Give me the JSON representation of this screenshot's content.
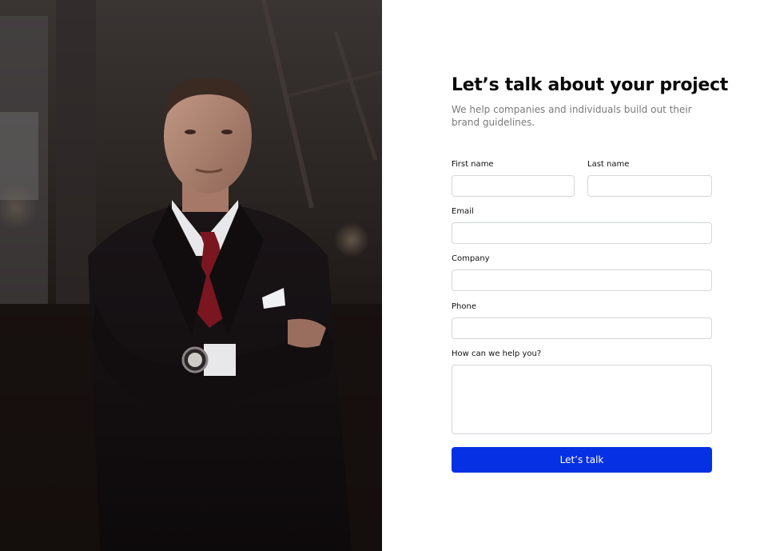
{
  "heading": {
    "title": "Let’s talk about your project",
    "subtitle": "We help companies and individuals build out their brand guidelines."
  },
  "form": {
    "first_name_label": "First name",
    "last_name_label": "Last name",
    "email_label": "Email",
    "company_label": "Company",
    "phone_label": "Phone",
    "message_label": "How can we help you?",
    "submit_label": "Let’s talk"
  },
  "colors": {
    "accent": "#0530e3",
    "title": "#0a0a0a",
    "subtitle": "#7a7a7a",
    "field_border": "#d3d6db"
  }
}
